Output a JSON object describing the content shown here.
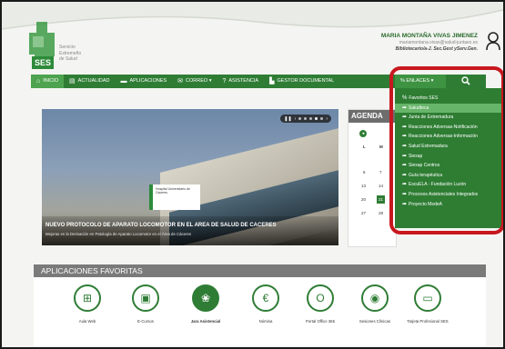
{
  "header": {
    "logo_abbr": "SES",
    "logo_text": [
      "Servicio",
      "Extremeño",
      "de Salud"
    ],
    "user_name": "MARIA MONTAÑA VIVAS JIMENEZ",
    "user_email": "mariamontana.vivas@salud-juntaex.es",
    "user_role": "Bibliotecario/a-J. Sec.Gest yServ.Gen."
  },
  "nav": {
    "items": [
      {
        "icon": "⌂",
        "label": "INICIO"
      },
      {
        "icon": "▤",
        "label": "ACTUALIDAD"
      },
      {
        "icon": "▬",
        "label": "APLICACIONES"
      },
      {
        "icon": "✉",
        "label": "CORREO ▾"
      },
      {
        "icon": "?",
        "label": "ASISTENCIA"
      },
      {
        "icon": "▙",
        "label": "GESTOR DOCUMENTAL"
      }
    ],
    "enlaces_label": "ENLACES ▾",
    "search_icon": "search-icon"
  },
  "dropdown": {
    "items": [
      {
        "label": "Favoritos SES"
      },
      {
        "label": "Saludteca"
      },
      {
        "label": "Junta de Extremadura"
      },
      {
        "label": "Reacciones Adversas-Notificación"
      },
      {
        "label": "Reacciones Adversas-Información"
      },
      {
        "label": "Salud Extremadura"
      },
      {
        "label": "Siexap"
      },
      {
        "label": "Siexap Centros"
      },
      {
        "label": "Guía terapéutica"
      },
      {
        "label": "EscuELA - Fundación Luzón"
      },
      {
        "label": "Procesos Asistenciales Integrados"
      },
      {
        "label": "Proyecto MedeA"
      }
    ]
  },
  "hero": {
    "sign_text": "Hospital Universitario de Cáceres",
    "title": "NUEVO PROTOCOLO DE APARATO LOCOMOTOR EN EL AREA DE SALUD DE CACERES",
    "subtitle": "Mejoras en la Derivación en Patología de Aparato Locomotor en el Área de Cáceres"
  },
  "agenda": {
    "title": "AGENDA",
    "day_headers": [
      "L",
      "M"
    ],
    "days": [
      "6",
      "7",
      "13",
      "14",
      "20",
      "21",
      "27",
      "28"
    ],
    "selected_day": "21"
  },
  "apps": {
    "title": "APLICACIONES FAVORITAS",
    "items": [
      {
        "icon": "⊞",
        "label": "Aula Web"
      },
      {
        "icon": "▣",
        "label": "E-Cursos"
      },
      {
        "icon": "❀",
        "label": "Jara Asistencial"
      },
      {
        "icon": "€",
        "label": "Nómina"
      },
      {
        "icon": "O",
        "label": "Portal Office 365"
      },
      {
        "icon": "◉",
        "label": "Sesiones Clínicas"
      },
      {
        "icon": "▭",
        "label": "Tarjeta Profesional SES"
      }
    ]
  },
  "colors": {
    "brand_green": "#2f7d35",
    "highlight_green": "#67b56a",
    "annotation_red": "#c8171e"
  }
}
